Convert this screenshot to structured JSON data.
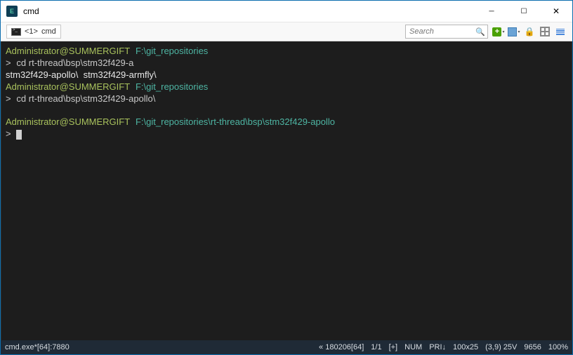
{
  "title": "cmd",
  "tab": {
    "index": "<1>",
    "label": "cmd"
  },
  "search_placeholder": "Search",
  "toolbar_icons": {
    "add": "add-icon",
    "floppy": "floppy-icon",
    "lock": "lock-icon",
    "grid": "grid-icon",
    "lines": "lines-icon"
  },
  "terminal": {
    "lines": [
      {
        "user": "Administrator@SUMMERGIFT",
        "path": "F:\\git_repositories"
      },
      {
        "prompt": ">",
        "cmd": "cd rt-thread\\bsp\\stm32f429-a"
      },
      {
        "out": "stm32f429-apollo\\  stm32f429-armfly\\"
      },
      {
        "user": "Administrator@SUMMERGIFT",
        "path": "F:\\git_repositories"
      },
      {
        "prompt": ">",
        "cmd": "cd rt-thread\\bsp\\stm32f429-apollo\\"
      },
      {
        "blank": true
      },
      {
        "user": "Administrator@SUMMERGIFT",
        "path": "F:\\git_repositories\\rt-thread\\bsp\\stm32f429-apollo"
      },
      {
        "prompt": ">",
        "cursor": true
      }
    ]
  },
  "statusbar": {
    "left": "cmd.exe*[64]:7880",
    "segments": [
      "« 180206[64]",
      "1/1",
      "[+]",
      "NUM",
      "PRI↓",
      "100x25",
      "(3,9) 25V",
      "9656",
      "100%"
    ]
  }
}
